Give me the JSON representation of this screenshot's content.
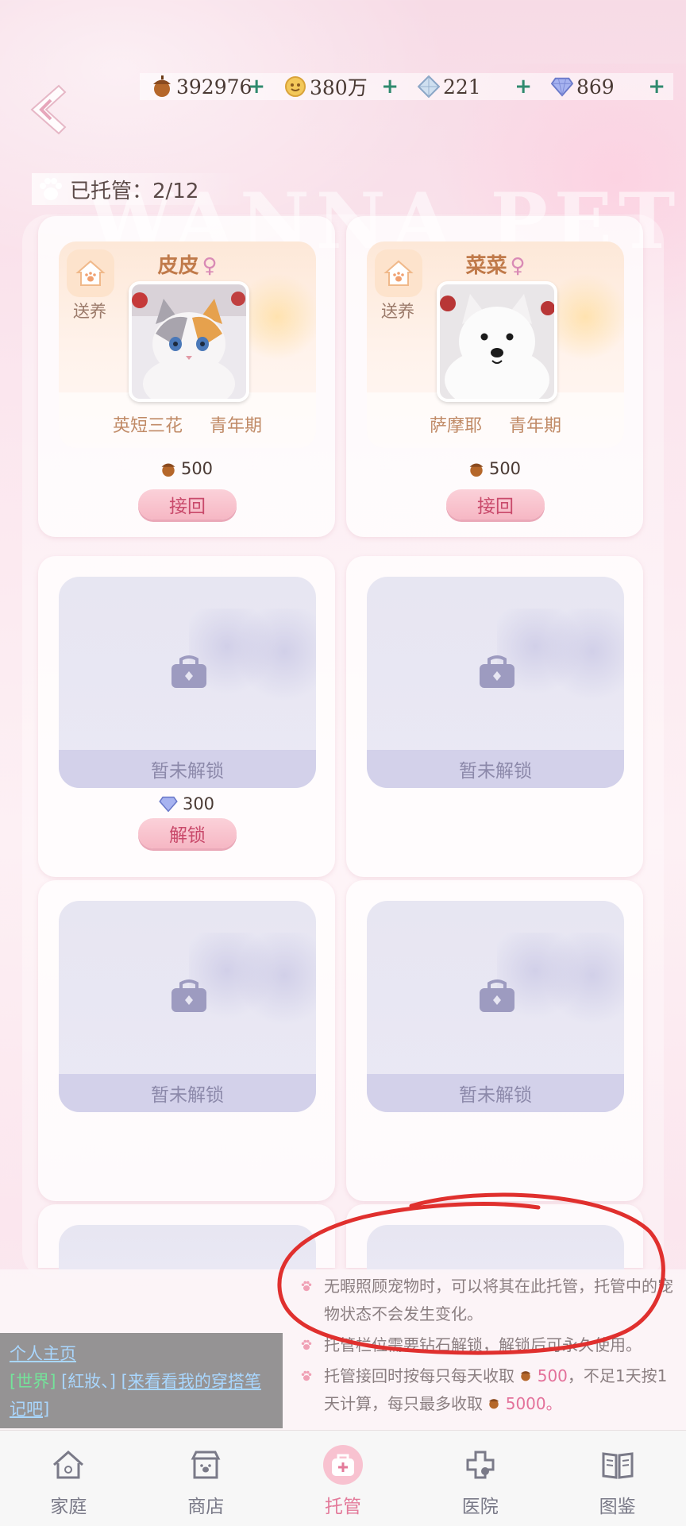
{
  "currencies": [
    {
      "icon": "acorn-icon",
      "value": "392976",
      "plus": "+"
    },
    {
      "icon": "gold-coin-icon",
      "value": "380万",
      "plus": "+"
    },
    {
      "icon": "crystal-icon",
      "value": "221",
      "plus": "+"
    },
    {
      "icon": "diamond-icon",
      "value": "869",
      "plus": "+"
    }
  ],
  "watermark": "WANNA PET",
  "hosted": {
    "label": "已托管：2/12"
  },
  "pets": [
    {
      "name": "皮皮",
      "gender": "♀",
      "adopt_label": "送养",
      "breed": "英短三花",
      "stage": "青年期",
      "cost": "500",
      "button": "接回",
      "photo": "cat-photo"
    },
    {
      "name": "菜菜",
      "gender": "♀",
      "adopt_label": "送养",
      "breed": "萨摩耶",
      "stage": "青年期",
      "cost": "500",
      "button": "接回",
      "photo": "dog-photo"
    }
  ],
  "locked_slots": [
    {
      "label": "暂未解锁",
      "cost": "300",
      "button": "解锁"
    },
    {
      "label": "暂未解锁"
    },
    {
      "label": "暂未解锁"
    },
    {
      "label": "暂未解锁"
    }
  ],
  "info": [
    {
      "text": "无暇照顾宠物时，可以将其在此托管，托管中的宠物状态不会发生变化。"
    },
    {
      "text": "托管栏位需要钻石解锁，解锁后可永久使用。"
    },
    {
      "pre": "托管接回时按每只每天收取",
      "amount1": "500",
      "mid": "，不足1天按1天计算，每只最多收取",
      "amount2": "5000",
      "post": "。"
    }
  ],
  "chat": {
    "profile": "个人主页",
    "channel": "[世界]",
    "user": "[紅妝、]",
    "message": "[来看看我的穿搭笔记吧]"
  },
  "nav": [
    {
      "label": "家庭",
      "icon": "home-icon"
    },
    {
      "label": "商店",
      "icon": "shop-icon"
    },
    {
      "label": "托管",
      "icon": "pet-care-icon",
      "active": true
    },
    {
      "label": "医院",
      "icon": "hospital-icon"
    },
    {
      "label": "图鉴",
      "icon": "book-icon"
    }
  ],
  "colors": {
    "accent": "#e37a9a",
    "button": "#f6b7c4",
    "annotation": "#e0302e"
  }
}
